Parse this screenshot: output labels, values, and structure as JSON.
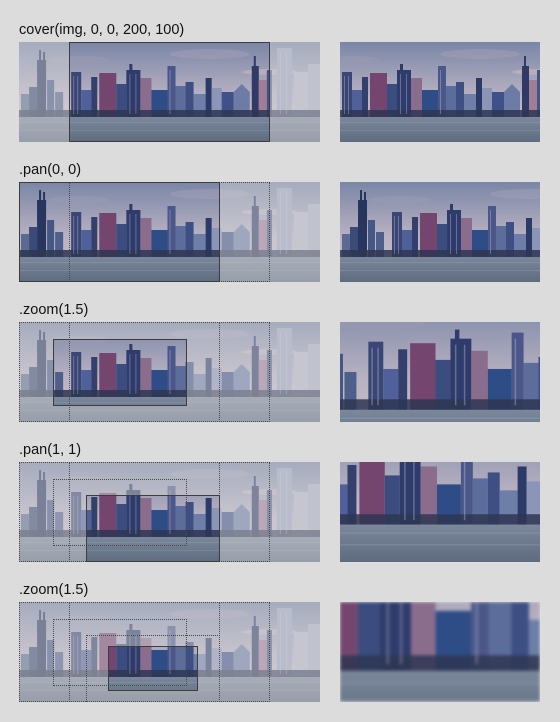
{
  "steps": [
    {
      "label": "cover(img, 0, 0, 200, 100)"
    },
    {
      "label": ".pan(0, 0)"
    },
    {
      "label": ".zoom(1.5)"
    },
    {
      "label": ".pan(1, 1)"
    },
    {
      "label": ".zoom(1.5)"
    }
  ],
  "colors": {
    "background": "#dcdcdc",
    "sky_top": "#6f7f9e",
    "sky_bottom": "#cdbfc4",
    "water": "#6d7a8d",
    "frame": "#3d3d3d"
  }
}
